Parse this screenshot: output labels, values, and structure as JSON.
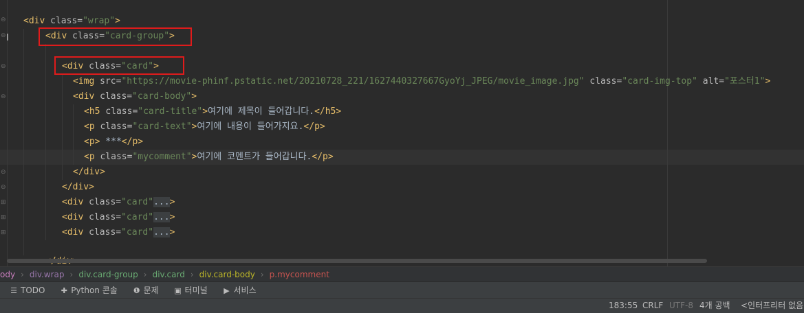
{
  "editor": {
    "lines": [
      {
        "indent": "",
        "parts": [
          [
            "tag",
            "<div "
          ],
          [
            "attr",
            "class="
          ],
          [
            "val",
            "\"wrap\""
          ],
          [
            "tag",
            ">"
          ]
        ]
      },
      {
        "indent": "",
        "parts": [
          [
            "tag",
            "<div "
          ],
          [
            "attr",
            "class="
          ],
          [
            "val",
            "\"card-group\""
          ],
          [
            "tag",
            ">"
          ]
        ]
      },
      {
        "indent": "",
        "parts": [
          [
            "tag",
            "<div "
          ],
          [
            "attr",
            "class="
          ],
          [
            "val",
            "\"card\""
          ],
          [
            "tag",
            ">"
          ]
        ]
      },
      {
        "indent": "",
        "parts": [
          [
            "tag",
            "<img "
          ],
          [
            "attr",
            "src="
          ],
          [
            "val",
            "\"https://movie-phinf.pstatic.net/20210728_221/1627440327667GyoYj_JPEG/movie_image.jpg\""
          ],
          [
            "attr",
            " class="
          ],
          [
            "val",
            "\"card-img-top\""
          ],
          [
            "attr",
            " alt="
          ],
          [
            "val",
            "\"포스터1\""
          ],
          [
            "tag",
            ">"
          ]
        ]
      },
      {
        "indent": "",
        "parts": [
          [
            "tag",
            "<div "
          ],
          [
            "attr",
            "class="
          ],
          [
            "val",
            "\"card-body\""
          ],
          [
            "tag",
            ">"
          ]
        ]
      },
      {
        "indent": "",
        "parts": [
          [
            "tag",
            "<h5 "
          ],
          [
            "attr",
            "class="
          ],
          [
            "val",
            "\"card-title\""
          ],
          [
            "tag",
            ">"
          ],
          [
            "txt",
            "여기에 제목이 들어갑니다."
          ],
          [
            "tag",
            "</h5>"
          ]
        ]
      },
      {
        "indent": "",
        "parts": [
          [
            "tag",
            "<p "
          ],
          [
            "attr",
            "class="
          ],
          [
            "val",
            "\"card-text\""
          ],
          [
            "tag",
            ">"
          ],
          [
            "txt",
            "여기에 내용이 들어가지요."
          ],
          [
            "tag",
            "</p>"
          ]
        ]
      },
      {
        "indent": "",
        "parts": [
          [
            "tag",
            "<p>"
          ],
          [
            "txt",
            " ***"
          ],
          [
            "tag",
            "</p>"
          ]
        ]
      },
      {
        "indent": "",
        "parts": [
          [
            "tag",
            "<p "
          ],
          [
            "attr",
            "class="
          ],
          [
            "val",
            "\"mycomment\""
          ],
          [
            "tag",
            ">"
          ],
          [
            "txt",
            "여기에 코멘트가 들어갑니다."
          ],
          [
            "tag",
            "</p>"
          ]
        ]
      },
      {
        "indent": "",
        "parts": [
          [
            "tag",
            "</div>"
          ]
        ]
      },
      {
        "indent": "",
        "parts": [
          [
            "tag",
            "</div>"
          ]
        ]
      },
      {
        "indent": "",
        "parts": [
          [
            "tag",
            "<div "
          ],
          [
            "attr",
            "class="
          ],
          [
            "val",
            "\"card\""
          ],
          [
            "fold",
            "..."
          ],
          [
            "tag",
            ">"
          ]
        ]
      },
      {
        "indent": "",
        "parts": [
          [
            "tag",
            "<div "
          ],
          [
            "attr",
            "class="
          ],
          [
            "val",
            "\"card\""
          ],
          [
            "fold",
            "..."
          ],
          [
            "tag",
            ">"
          ]
        ]
      },
      {
        "indent": "",
        "parts": [
          [
            "tag",
            "<div "
          ],
          [
            "attr",
            "class="
          ],
          [
            "val",
            "\"card\""
          ],
          [
            "fold",
            "..."
          ],
          [
            "tag",
            ">"
          ]
        ]
      },
      {
        "indent": "",
        "parts": []
      },
      {
        "indent": "",
        "parts": [
          [
            "tag",
            "</div>"
          ]
        ]
      }
    ]
  },
  "breadcrumb": [
    {
      "label": "ody",
      "color": "#c77dbb"
    },
    {
      "label": "div.wrap",
      "color": "#9876aa"
    },
    {
      "label": "div.card-group",
      "color": "#6aab73"
    },
    {
      "label": "div.card",
      "color": "#6aab73"
    },
    {
      "label": "div.card-body",
      "color": "#bbb529"
    },
    {
      "label": "p.mycomment",
      "color": "#c75450"
    }
  ],
  "toolbar": {
    "todo": "TODO",
    "python_console": "Python 콘솔",
    "problems": "문제",
    "terminal": "터미널",
    "services": "서비스"
  },
  "status": {
    "position": "183:55",
    "line_sep": "CRLF",
    "encoding": "UTF-8",
    "indent": "4개 공백",
    "interpreter": "<인터프리터 없음"
  },
  "colors": {
    "highlight_box": "#e01b1b",
    "tag": "#e8bf6a",
    "string": "#6a8759",
    "attribute": "#bababa"
  }
}
